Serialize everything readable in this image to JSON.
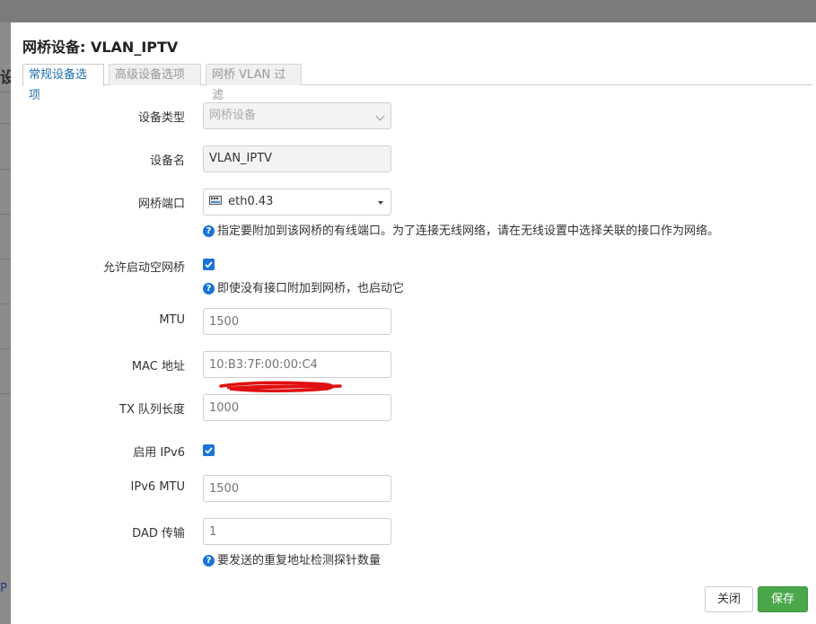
{
  "background": {
    "left_char": "设",
    "bottom_char": "P"
  },
  "modal": {
    "title": "网桥设备: VLAN_IPTV",
    "tabs": [
      {
        "label": "常规设备选项",
        "active": true
      },
      {
        "label": "高级设备选项",
        "active": false
      },
      {
        "label": "网桥 VLAN 过滤",
        "active": false
      }
    ],
    "fields": {
      "device_type": {
        "label": "设备类型",
        "value": "网桥设备"
      },
      "device_name": {
        "label": "设备名",
        "value": "VLAN_IPTV"
      },
      "bridge_ports": {
        "label": "网桥端口",
        "value": "eth0.43",
        "help": "指定要附加到该网桥的有线端口。为了连接无线网络，请在无线设置中选择关联的接口作为网络。"
      },
      "bring_up_empty": {
        "label": "允许启动空网桥",
        "checked": true,
        "help": "即使没有接口附加到网桥，也启动它"
      },
      "mtu": {
        "label": "MTU",
        "placeholder": "1500"
      },
      "mac": {
        "label": "MAC 地址",
        "placeholder": "10:B3:7F:00:00:C4"
      },
      "txqueuelen": {
        "label": "TX 队列长度",
        "placeholder": "1000"
      },
      "ipv6": {
        "label": "启用 IPv6",
        "checked": true
      },
      "ipv6_mtu": {
        "label": "IPv6 MTU",
        "placeholder": "1500"
      },
      "dad": {
        "label": "DAD 传输",
        "placeholder": "1",
        "help": "要发送的重复地址检测探针数量"
      }
    },
    "buttons": {
      "close": "关闭",
      "save": "保存"
    },
    "colors": {
      "accent": "#1a73d8",
      "save": "#4aa84a",
      "redaction": "#e01010"
    }
  }
}
